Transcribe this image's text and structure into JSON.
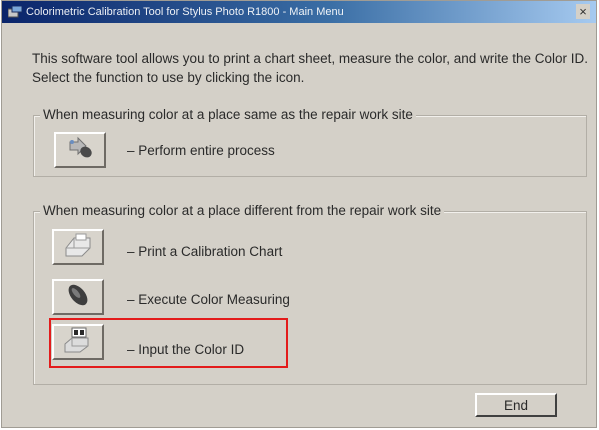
{
  "window": {
    "title": "Colorimetric Calibration Tool for Stylus Photo R1800 - Main Menu",
    "close_glyph": "×"
  },
  "intro_text": "This software tool allows you to print a chart sheet, measure the color, and write the Color ID. Select the function to use by clicking the icon.",
  "groups": [
    {
      "label": "When measuring color at a place same as the repair work site",
      "items": [
        {
          "icon": "perform-process-icon",
          "label": "– Perform entire process"
        }
      ]
    },
    {
      "label": "When measuring color at a place different from the repair work site",
      "items": [
        {
          "icon": "printer-icon",
          "label": "– Print a Calibration Chart"
        },
        {
          "icon": "measuring-device-icon",
          "label": "– Execute Color Measuring"
        },
        {
          "icon": "input-id-icon",
          "label": "– Input the Color ID"
        }
      ]
    }
  ],
  "end_button_label": "End",
  "colors": {
    "titlebar_start": "#0a246a",
    "titlebar_end": "#a6caf0",
    "face": "#d4d0c8",
    "highlight": "#e31b1b"
  }
}
